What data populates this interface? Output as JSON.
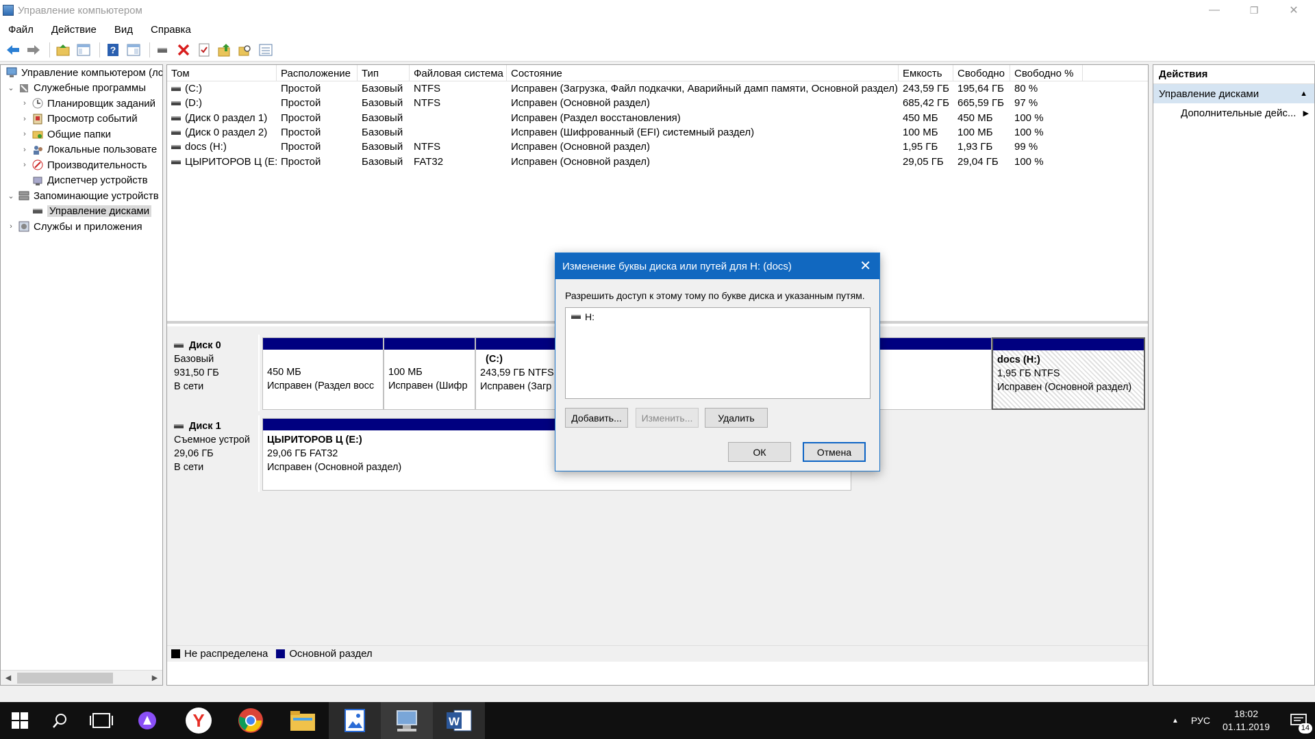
{
  "window": {
    "title": "Управление компьютером",
    "minimize": "—",
    "restore": "❐",
    "close": "✕"
  },
  "menu": [
    "Файл",
    "Действие",
    "Вид",
    "Справка"
  ],
  "toolbar_icons": [
    "back-arrow-icon",
    "forward-arrow-icon",
    "up-folder-icon",
    "show-hide-tree-icon",
    "help-icon",
    "properties-icon",
    "connect-icon",
    "delete-icon",
    "check-icon",
    "export-icon",
    "search-icon",
    "list-icon"
  ],
  "tree": {
    "root": "Управление компьютером (лс",
    "items": [
      {
        "label": "Служебные программы",
        "level": 1,
        "twisty": "⌄"
      },
      {
        "label": "Планировщик заданий",
        "level": 2,
        "twisty": "›"
      },
      {
        "label": "Просмотр событий",
        "level": 2,
        "twisty": "›"
      },
      {
        "label": "Общие папки",
        "level": 2,
        "twisty": "›"
      },
      {
        "label": "Локальные пользовате",
        "level": 2,
        "twisty": "›"
      },
      {
        "label": "Производительность",
        "level": 2,
        "twisty": "›"
      },
      {
        "label": "Диспетчер устройств",
        "level": 2,
        "twisty": ""
      },
      {
        "label": "Запоминающие устройств",
        "level": 1,
        "twisty": "⌄"
      },
      {
        "label": "Управление дисками",
        "level": 2,
        "twisty": "",
        "selected": true
      },
      {
        "label": "Службы и приложения",
        "level": 1,
        "twisty": "›"
      }
    ]
  },
  "volumes": {
    "columns": [
      "Том",
      "Расположение",
      "Тип",
      "Файловая система",
      "Состояние",
      "Емкость",
      "Свободно",
      "Свободно %"
    ],
    "rows": [
      [
        "(C:)",
        "Простой",
        "Базовый",
        "NTFS",
        "Исправен (Загрузка, Файл подкачки, Аварийный дамп памяти, Основной раздел)",
        "243,59 ГБ",
        "195,64 ГБ",
        "80 %"
      ],
      [
        "(D:)",
        "Простой",
        "Базовый",
        "NTFS",
        "Исправен (Основной раздел)",
        "685,42 ГБ",
        "665,59 ГБ",
        "97 %"
      ],
      [
        "(Диск 0 раздел 1)",
        "Простой",
        "Базовый",
        "",
        "Исправен (Раздел восстановления)",
        "450 МБ",
        "450 МБ",
        "100 %"
      ],
      [
        "(Диск 0 раздел 2)",
        "Простой",
        "Базовый",
        "",
        "Исправен (Шифрованный (EFI) системный раздел)",
        "100 МБ",
        "100 МБ",
        "100 %"
      ],
      [
        "docs (H:)",
        "Простой",
        "Базовый",
        "NTFS",
        "Исправен (Основной раздел)",
        "1,95 ГБ",
        "1,93 ГБ",
        "99 %"
      ],
      [
        "ЦЫРИТОРОВ Ц (E:)",
        "Простой",
        "Базовый",
        "FAT32",
        "Исправен (Основной раздел)",
        "29,05 ГБ",
        "29,04 ГБ",
        "100 %"
      ]
    ]
  },
  "disks": {
    "disk0": {
      "name": "Диск 0",
      "type": "Базовый",
      "size": "931,50 ГБ",
      "status": "В сети",
      "partitions": [
        {
          "title": "",
          "size": "450 МБ",
          "status": "Исправен (Раздел восс"
        },
        {
          "title": "",
          "size": "100 МБ",
          "status": "Исправен (Шифр"
        },
        {
          "title": "(C:)",
          "size": "243,59 ГБ NTFS",
          "status": "Исправен (Загр"
        },
        {
          "title": "docs  (H:)",
          "size": "1,95 ГБ NTFS",
          "status": "Исправен (Основной раздел)"
        }
      ]
    },
    "disk1": {
      "name": "Диск 1",
      "type": "Съемное устрой",
      "size": "29,06 ГБ",
      "status": "В сети",
      "partitions": [
        {
          "title": "ЦЫРИТОРОВ Ц  (E:)",
          "size": "29,06 ГБ FAT32",
          "status": "Исправен (Основной раздел)"
        }
      ]
    }
  },
  "legend": {
    "unallocated": "Не распределена",
    "primary": "Основной раздел",
    "unallocated_color": "#000000",
    "primary_color": "#000080"
  },
  "actions": {
    "header": "Действия",
    "section": "Управление дисками",
    "section_arrow": "▲",
    "more": "Дополнительные дейс...",
    "more_arrow": "▶"
  },
  "dialog": {
    "title": "Изменение буквы диска или путей для H: (docs)",
    "close": "✕",
    "description": "Разрешить доступ к этому тому по букве диска и указанным путям.",
    "list_items": [
      "H:"
    ],
    "add_button": "Добавить...",
    "change_button": "Изменить...",
    "delete_button": "Удалить",
    "ok_button": "ОК",
    "cancel_button": "Отмена"
  },
  "taskbar": {
    "lang": "РУС",
    "time": "18:02",
    "date": "01.11.2019",
    "notifications": "14",
    "tray_arrow": "▲"
  }
}
